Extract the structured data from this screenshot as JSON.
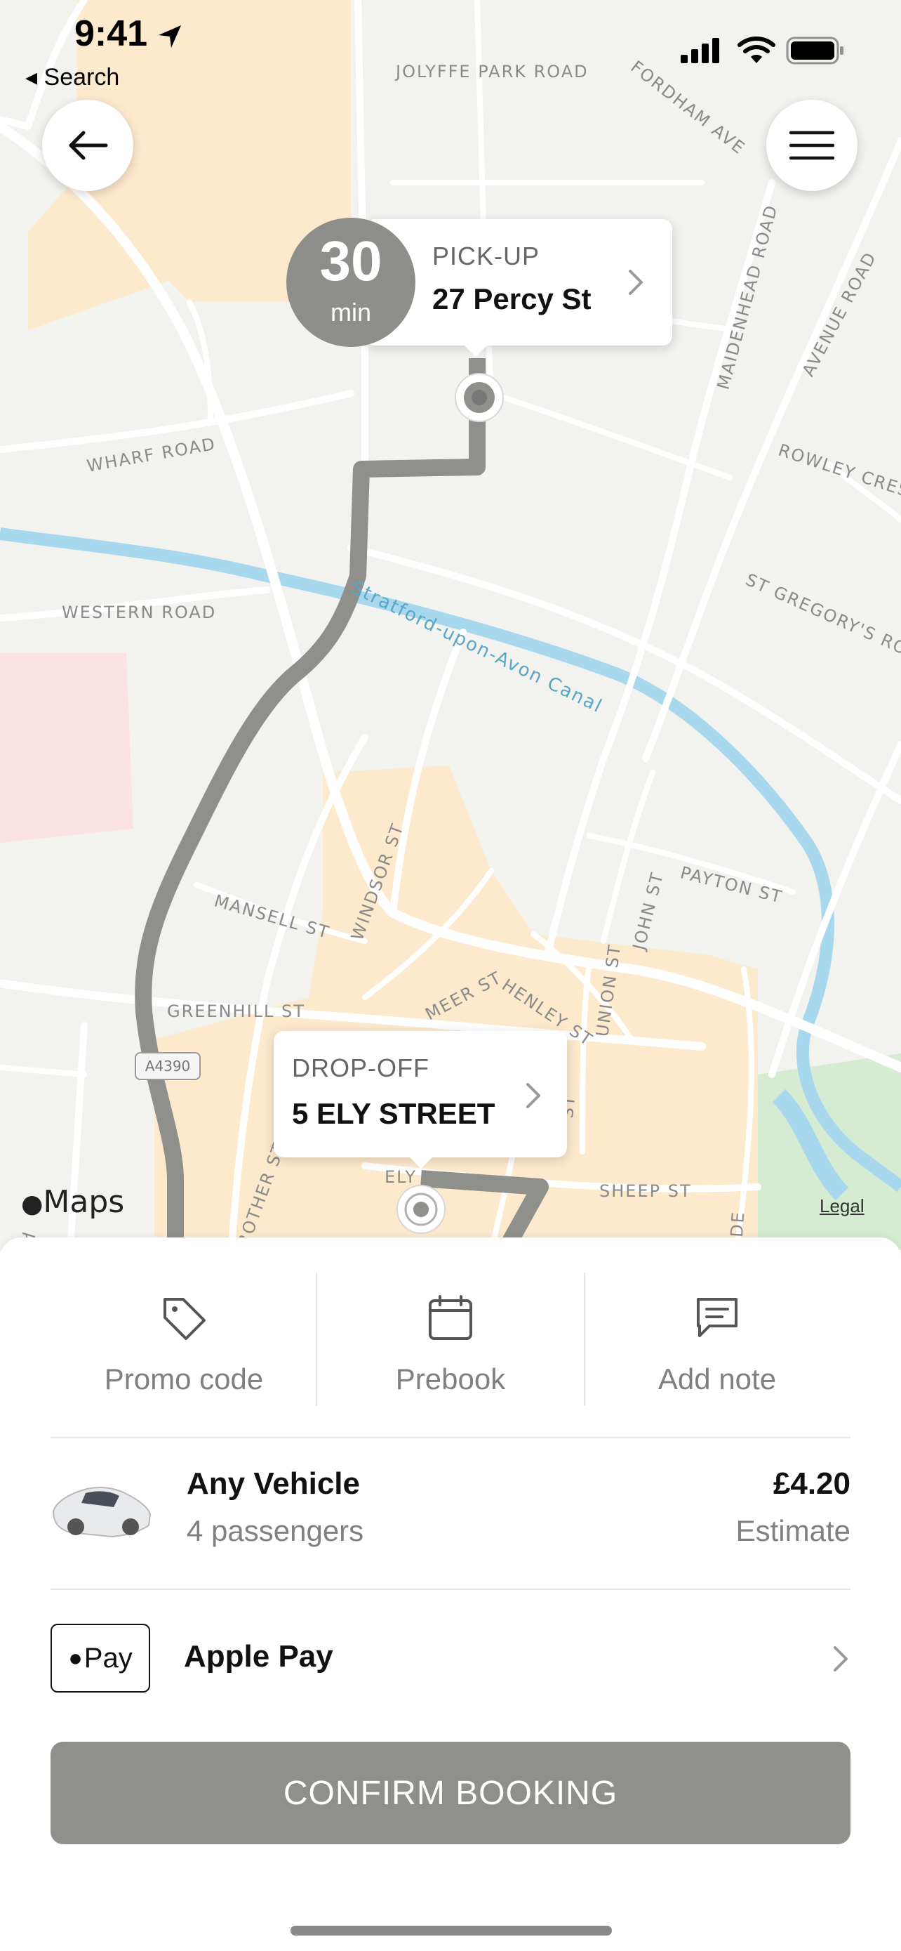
{
  "status_bar": {
    "time": "9:41",
    "back_label": "◂ Search"
  },
  "map": {
    "road_labels": {
      "jolyffe": "JOLYFFE PARK ROAD",
      "fordham": "FORDHAM AVE",
      "maidenhead": "MAIDENHEAD ROAD",
      "avenue": "AVENUE ROAD",
      "rowley": "ROWLEY CRESC",
      "wharf": "WHARF ROAD",
      "western": "WESTERN ROAD",
      "st_gregorys": "ST GREGORY'S ROA",
      "mansell": "MANSELL ST",
      "windsor": "WINDSOR ST",
      "payton": "PAYTON ST",
      "john": "JOHN ST",
      "greenhill": "GREENHILL ST",
      "meer": "MEER ST",
      "henley": "HENLEY ST",
      "union": "UNION ST",
      "sheep": "SHEEP ST",
      "ely": "ELY",
      "albany": "ALBANY RO",
      "rother": "ROTHER ST",
      "st_short": "ST",
      "side": "SIDE"
    },
    "canal_label": "Stratford-upon-Avon Canal",
    "road_shield": "A4390",
    "maps_logo": "Maps",
    "legal": "Legal",
    "eta": {
      "value": "30",
      "unit": "min"
    },
    "pickup": {
      "caption": "PICK-UP",
      "address": "27 Percy St"
    },
    "dropoff": {
      "caption": "DROP-OFF",
      "address": "5 ELY STREET"
    },
    "colors": {
      "route": "#8f8f8b",
      "water": "#a8d8ee",
      "buildings": "#fde9cc",
      "park": "#d6ecd2"
    }
  },
  "actions": [
    {
      "label": "Promo code",
      "icon": "tag-icon"
    },
    {
      "label": "Prebook",
      "icon": "calendar-icon"
    },
    {
      "label": "Add note",
      "icon": "message-icon"
    }
  ],
  "vehicle": {
    "name": "Any Vehicle",
    "passengers": "4 passengers",
    "price": "£4.20",
    "price_note": "Estimate"
  },
  "payment": {
    "badge": "Pay",
    "method": "Apple Pay"
  },
  "confirm_label": "CONFIRM BOOKING"
}
